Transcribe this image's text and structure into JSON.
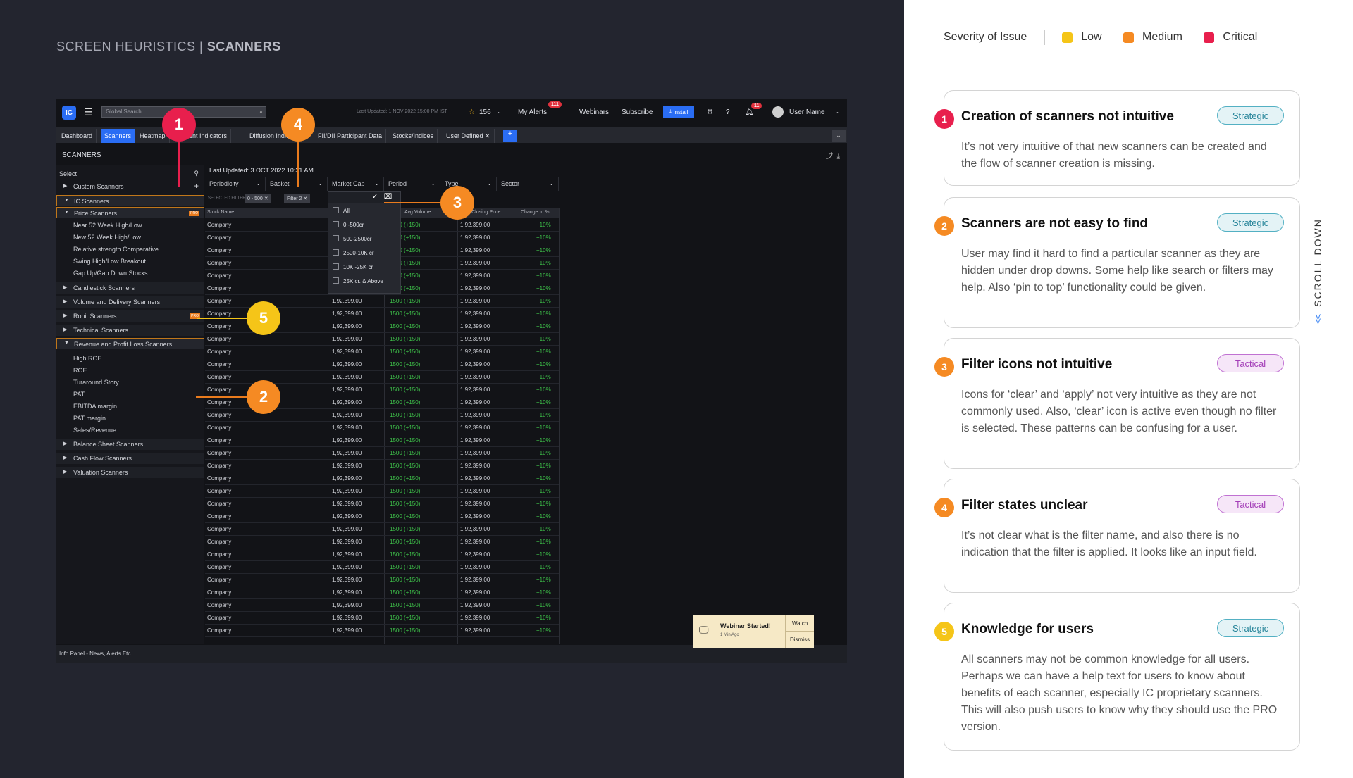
{
  "page": {
    "title_light": "SCREEN HEURISTICS | ",
    "title_bold": "SCANNERS"
  },
  "app": {
    "search_placeholder": "Global Search",
    "last_updated": "Last Updated: 1 NOV 2022 15:00 PM IST",
    "star_count": "156",
    "my_alerts": "My Alerts",
    "alerts_badge": "111",
    "webinars": "Webinars",
    "subscribe": "Subscribe",
    "install": "Install",
    "notif_badge": "11",
    "user_name": "User Name",
    "tabs": [
      "Dashboard",
      "Scanners",
      "Heatmap",
      "Sentiment Indicators",
      "Diffusion Indicators",
      "FII/DII Participant Data",
      "Stocks/Indices",
      "User Defined"
    ],
    "section_title": "SCANNERS",
    "sidebar": {
      "select": "Select",
      "custom": "Custom Scanners",
      "ic": "IC Scanners",
      "price": "Price Scanners",
      "pro": "PRO",
      "price_items": [
        "Near 52 Week High/Low",
        "New 52 Week High/Low",
        "Relative strength Comparative",
        "Swing High/Low Breakout",
        "Gap Up/Gap Down Stocks"
      ],
      "candlestick": "Candlestick Scanners",
      "volume": "Volume and Delivery Scanners",
      "rohit": "Rohit Scanners",
      "technical": "Technical Scanners",
      "revenue": "Revenue and Profit Loss Scanners",
      "revenue_items": [
        "High ROE",
        "ROE",
        "Turaround Story",
        "PAT",
        "EBITDA margin",
        "PAT margin",
        "Sales/Revenue"
      ],
      "balance": "Balance Sheet Scanners",
      "cashflow": "Cash Flow Scanners",
      "valuation": "Valuation Scanners"
    },
    "content_updated": "Last Updated: 3 OCT 2022 10:31 AM",
    "filters": [
      "Periodicity",
      "Basket",
      "Market Cap",
      "Period",
      "Type",
      "Sector"
    ],
    "selected_filters_label": "SELECTED FILTERS",
    "chip1": "0 - 500",
    "chip2": "Filter 2",
    "columns": [
      "Stock Name",
      "Avg Volume",
      "Last Closing Price",
      "Change In %"
    ],
    "market_cap_options": [
      "All",
      "0 -500cr",
      "500-2500cr",
      "2500-10K cr",
      "10K -25K cr",
      "25K cr. & Above"
    ],
    "row": {
      "name": "Company",
      "price": "1,92,399.00",
      "volume": "1500 (+150)",
      "change": "+10%"
    },
    "info_panel": "Info Panel - News, Alerts Etc",
    "toast": {
      "title": "Webinar Started!",
      "sub": "1 Min Ago",
      "watch": "Watch",
      "dismiss": "Dismiss"
    }
  },
  "markers": [
    "1",
    "2",
    "3",
    "4",
    "5"
  ],
  "legend": {
    "label": "Severity of Issue",
    "low": "Low",
    "medium": "Medium",
    "critical": "Critical",
    "colors": {
      "low": "#f5c518",
      "medium": "#f58a23",
      "critical": "#e81f4d"
    }
  },
  "issues": [
    {
      "num": "1",
      "title": "Creation of scanners not intuitive",
      "tag": "Strategic",
      "desc": "It’s not very intuitive of that new scanners can be created and the flow of scanner creation is missing."
    },
    {
      "num": "2",
      "title": "Scanners are not easy to find",
      "tag": "Strategic",
      "desc": "User may find it hard to find a particular scanner as they are hidden under drop downs. Some help like search or filters may help. Also ‘pin to top’ functionality could be given."
    },
    {
      "num": "3",
      "title": "Filter icons not intuitive",
      "tag": "Tactical",
      "desc": "Icons for ‘clear’ and ‘apply’ not very intuitive as they are not commonly used. Also, ‘clear’ icon is active even though no filter is selected. These patterns can be confusing for a user."
    },
    {
      "num": "4",
      "title": "Filter states unclear",
      "tag": "Tactical",
      "desc": "It’s not clear what is the filter name, and also there is no indication that the filter is applied. It looks like an input field."
    },
    {
      "num": "5",
      "title": "Knowledge for users",
      "tag": "Strategic",
      "desc": "All scanners may not be common knowledge for all users. Perhaps we can have a help text for users to know about benefits of each scanner, especially IC proprietary scanners. This will also push users to know why they should use the PRO version."
    }
  ],
  "scroll": "SCROLL DOWN"
}
